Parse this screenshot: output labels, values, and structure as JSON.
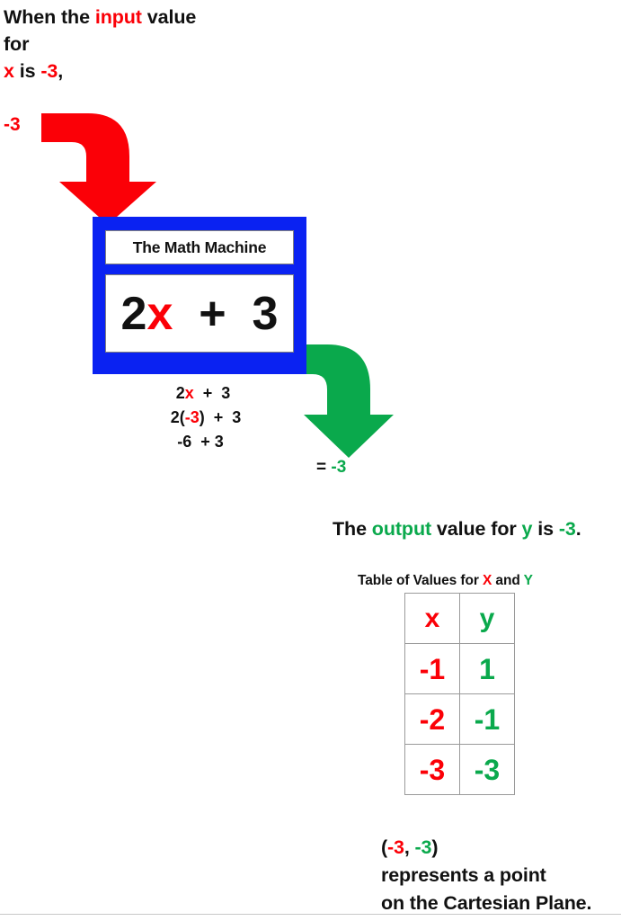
{
  "colors": {
    "red": "#fb0007",
    "green": "#0aa94c",
    "blue": "#0a22f2",
    "black": "#111111",
    "white": "#ffffff",
    "border_gray": "#9a9a9a"
  },
  "intro": {
    "line1_a": "When the ",
    "line1_b": "input",
    "line1_c": " value",
    "line2": "for",
    "line3_a": "x",
    "line3_b": " is ",
    "line3_c": "-3",
    "line3_d": ","
  },
  "input": {
    "value_label": "-3",
    "arrow_icon": "bent-arrow-down-red"
  },
  "machine": {
    "title": "The Math Machine",
    "formula_a": "2",
    "formula_b": "x",
    "formula_c": "  +  3"
  },
  "work": {
    "line1_a": "2",
    "line1_b": "x",
    "line1_c": "  +  3",
    "line2_a": "2(",
    "line2_b": "-3",
    "line2_c": ")  +  3",
    "line3": "-6  + 3"
  },
  "output": {
    "arrow_icon": "bent-arrow-down-green",
    "result_equals": "= ",
    "result_value": "-3",
    "sentence_a": "The ",
    "sentence_b": "output",
    "sentence_c": " value for ",
    "sentence_d": "y",
    "sentence_e": " is ",
    "sentence_f": "-3",
    "sentence_g": "."
  },
  "table": {
    "caption_a": "Table of Values for ",
    "caption_b": "X",
    "caption_c": " and ",
    "caption_d": "Y",
    "headers": {
      "x": "x",
      "y": "y"
    },
    "rows": [
      {
        "x": "-1",
        "y": "1"
      },
      {
        "x": "-2",
        "y": "-1"
      },
      {
        "x": "-3",
        "y": "-3"
      }
    ]
  },
  "conclusion": {
    "line1_a": "(",
    "line1_b": "-3",
    "line1_c": ", ",
    "line1_d": "-3",
    "line1_e": ")",
    "line2": "represents a point",
    "line3": "on the Cartesian Plane."
  }
}
